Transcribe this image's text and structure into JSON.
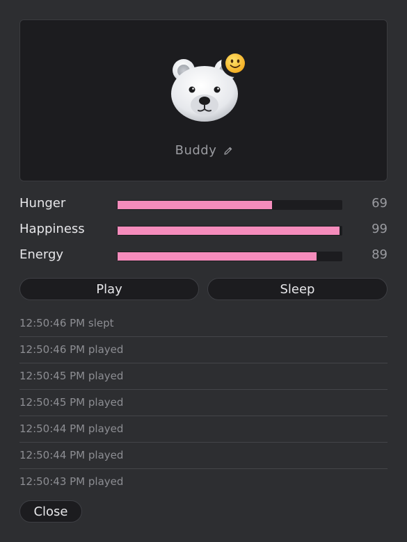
{
  "pet": {
    "name": "Buddy",
    "avatar_icon": "polar-bear-face-icon",
    "mood_icon": "slightly-smiling-face-icon"
  },
  "stats": [
    {
      "label": "Hunger",
      "value": "69",
      "level": 0.69
    },
    {
      "label": "Happiness",
      "value": "99",
      "level": 0.99
    },
    {
      "label": "Energy",
      "value": "89",
      "level": 0.89
    }
  ],
  "actions": {
    "play_label": "Play",
    "sleep_label": "Sleep"
  },
  "log": [
    "12:50:46 PM slept",
    "12:50:46 PM played",
    "12:50:45 PM played",
    "12:50:45 PM played",
    "12:50:44 PM played",
    "12:50:44 PM played",
    "12:50:43 PM played"
  ],
  "close_label": "Close",
  "colors": {
    "background": "#2d2e31",
    "card": "#1c1c1f",
    "stat_fill": "#f58cbc"
  }
}
